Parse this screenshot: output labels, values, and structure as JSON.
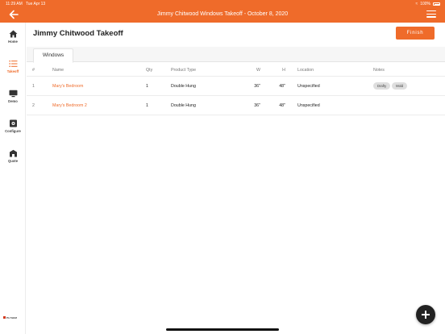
{
  "status_bar": {
    "time": "11:29 AM",
    "date": "Tue Apr 13",
    "battery": "100%"
  },
  "header": {
    "title": "Jimmy Chitwood Windows Takeoff - October 8, 2020"
  },
  "sidebar": {
    "items": [
      {
        "label": "Home",
        "icon": "home-icon"
      },
      {
        "label": "Takeoff",
        "icon": "list-icon",
        "active": true
      },
      {
        "label": "Demo",
        "icon": "monitor-icon"
      },
      {
        "label": "Configure",
        "icon": "configure-icon"
      },
      {
        "label": "Quote",
        "icon": "quote-icon"
      }
    ],
    "brand": "PLYGEM"
  },
  "main": {
    "title": "Jimmy Chitwood Takeoff",
    "finish_label": "Finish",
    "tabs": [
      {
        "label": "Windows"
      }
    ]
  },
  "table": {
    "columns": {
      "num": "#",
      "name": "Name",
      "qty": "Qty",
      "type": "Product Type",
      "w": "W",
      "h": "H",
      "location": "Location",
      "notes": "Notes"
    },
    "rows": [
      {
        "num": "1",
        "name": "Mary's Bedroom",
        "qty": "1",
        "type": "Double Hung",
        "w": "36\"",
        "h": "48\"",
        "location": "Unspecified",
        "notes": [
          "Drafty",
          "Mold"
        ]
      },
      {
        "num": "2",
        "name": "Mary's Bedroom 2",
        "qty": "1",
        "type": "Double Hung",
        "w": "36\"",
        "h": "48\"",
        "location": "Unspecified",
        "notes": []
      }
    ]
  },
  "colors": {
    "accent": "#ef6b2a",
    "fab": "#222222"
  }
}
